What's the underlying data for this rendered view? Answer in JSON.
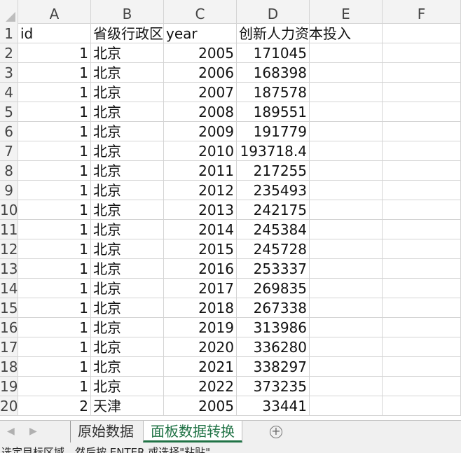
{
  "columns": [
    "A",
    "B",
    "C",
    "D",
    "E",
    "F"
  ],
  "header_row": {
    "num": "1",
    "cells": [
      "id",
      "省级行政区",
      "year",
      "创新人力资本投入",
      "",
      ""
    ]
  },
  "rows": [
    {
      "num": "2",
      "id": "1",
      "region": "北京",
      "year": "2005",
      "value": "171045"
    },
    {
      "num": "3",
      "id": "1",
      "region": "北京",
      "year": "2006",
      "value": "168398"
    },
    {
      "num": "4",
      "id": "1",
      "region": "北京",
      "year": "2007",
      "value": "187578"
    },
    {
      "num": "5",
      "id": "1",
      "region": "北京",
      "year": "2008",
      "value": "189551"
    },
    {
      "num": "6",
      "id": "1",
      "region": "北京",
      "year": "2009",
      "value": "191779"
    },
    {
      "num": "7",
      "id": "1",
      "region": "北京",
      "year": "2010",
      "value": "193718.4"
    },
    {
      "num": "8",
      "id": "1",
      "region": "北京",
      "year": "2011",
      "value": "217255"
    },
    {
      "num": "9",
      "id": "1",
      "region": "北京",
      "year": "2012",
      "value": "235493"
    },
    {
      "num": "10",
      "id": "1",
      "region": "北京",
      "year": "2013",
      "value": "242175"
    },
    {
      "num": "11",
      "id": "1",
      "region": "北京",
      "year": "2014",
      "value": "245384"
    },
    {
      "num": "12",
      "id": "1",
      "region": "北京",
      "year": "2015",
      "value": "245728"
    },
    {
      "num": "13",
      "id": "1",
      "region": "北京",
      "year": "2016",
      "value": "253337"
    },
    {
      "num": "14",
      "id": "1",
      "region": "北京",
      "year": "2017",
      "value": "269835"
    },
    {
      "num": "15",
      "id": "1",
      "region": "北京",
      "year": "2018",
      "value": "267338"
    },
    {
      "num": "16",
      "id": "1",
      "region": "北京",
      "year": "2019",
      "value": "313986"
    },
    {
      "num": "17",
      "id": "1",
      "region": "北京",
      "year": "2020",
      "value": "336280"
    },
    {
      "num": "18",
      "id": "1",
      "region": "北京",
      "year": "2021",
      "value": "338297"
    },
    {
      "num": "19",
      "id": "1",
      "region": "北京",
      "year": "2022",
      "value": "373235"
    },
    {
      "num": "20",
      "id": "2",
      "region": "天津",
      "year": "2005",
      "value": "33441"
    }
  ],
  "sheet_tabs": [
    {
      "label": "原始数据",
      "active": false
    },
    {
      "label": "面板数据转换",
      "active": true
    }
  ],
  "nav": {
    "prev_icon": "◀",
    "next_icon": "▶"
  },
  "add_sheet_icon": "+",
  "status_text": "选定目标区域，然后按 ENTER 或选择\"粘贴\"",
  "colors": {
    "active_tab": "#217346",
    "grid_line": "#d4d4d4",
    "header_bg": "#f3f3f3"
  }
}
